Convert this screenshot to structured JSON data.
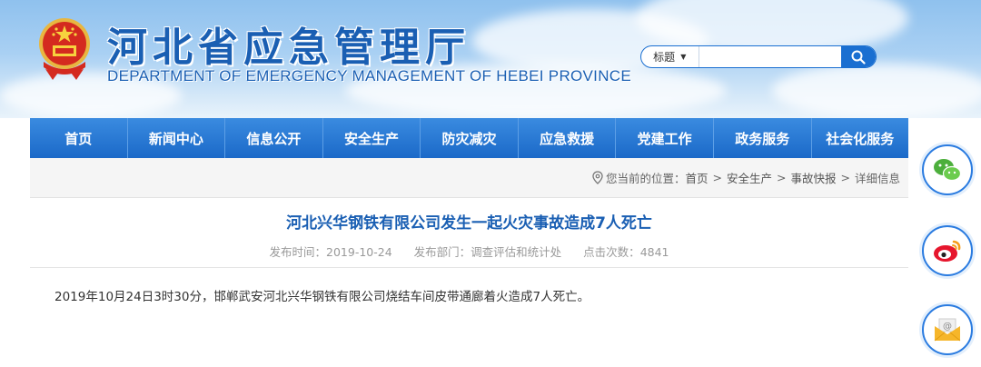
{
  "header": {
    "title_cn": "河北省应急管理厅",
    "title_en": "DEPARTMENT OF EMERGENCY MANAGEMENT OF HEBEI PROVINCE"
  },
  "search": {
    "select_value": "标题",
    "placeholder": "",
    "button_icon": "search-icon"
  },
  "nav": {
    "items": [
      "首页",
      "新闻中心",
      "信息公开",
      "安全生产",
      "防灾减灾",
      "应急救援",
      "党建工作",
      "政务服务",
      "社会化服务"
    ]
  },
  "breadcrumb": {
    "prefix": "您当前的位置：",
    "items": [
      "首页",
      "安全生产",
      "事故快报",
      "详细信息"
    ]
  },
  "article": {
    "title": "河北兴华钢铁有限公司发生一起火灾事故造成7人死亡",
    "publish_label": "发布时间：",
    "publish_date": "2019-10-24",
    "dept_label": "发布部门：",
    "dept": "调查评估和统计处",
    "clicks_label": "点击次数：",
    "clicks": "4841",
    "body": "2019年10月24日3时30分，邯郸武安河北兴华钢铁有限公司烧结车间皮带通廊着火造成7人死亡。"
  },
  "side": {
    "icons": [
      "wechat-icon",
      "weibo-icon",
      "email-icon"
    ]
  },
  "colors": {
    "brand_blue": "#1a6fd1",
    "title_blue": "#1a5fb3"
  }
}
